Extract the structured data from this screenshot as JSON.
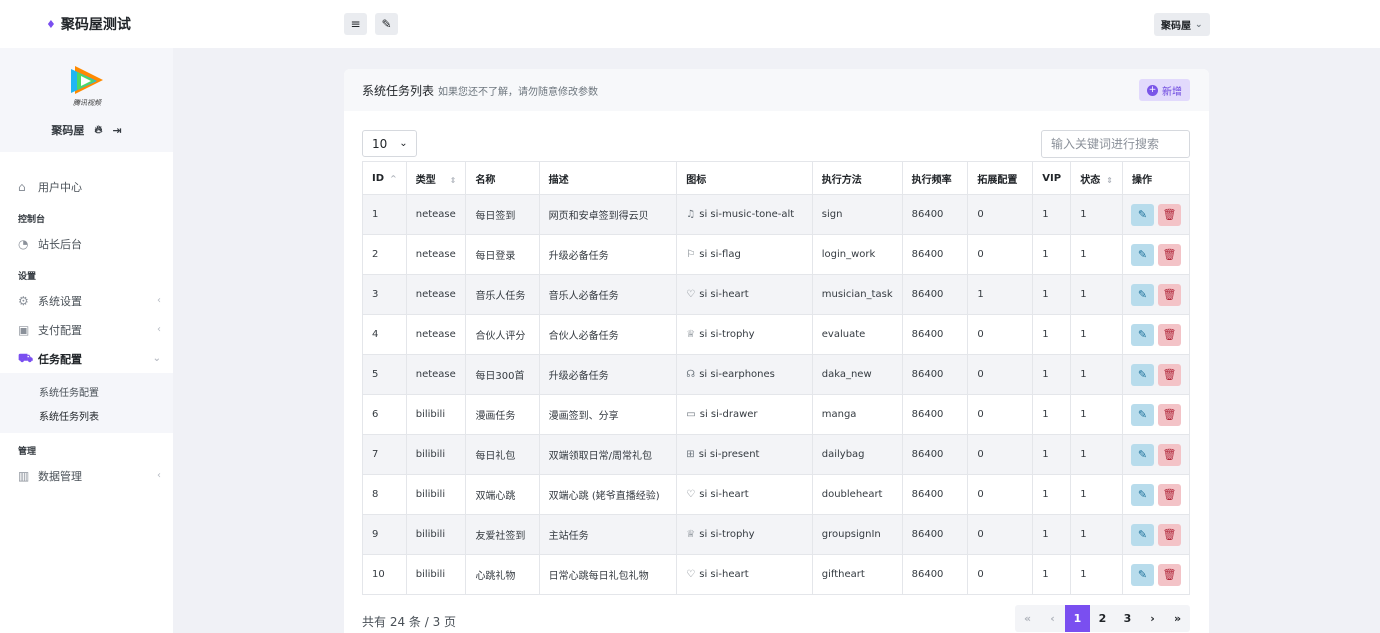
{
  "brand": {
    "title": "聚码屋测试"
  },
  "user": {
    "name": "聚码屋",
    "logo_text": "腾讯视频"
  },
  "sidebar": {
    "user_center": "用户中心",
    "sec_console": "控制台",
    "admin": "站长后台",
    "sec_settings": "设置",
    "system_settings": "系统设置",
    "payment_settings": "支付配置",
    "task_settings": "任务配置",
    "sub_task_config": "系统任务配置",
    "sub_task_list": "系统任务列表",
    "sec_manage": "管理",
    "data_manage": "数据管理"
  },
  "header": {
    "user_menu": "聚码屋"
  },
  "card": {
    "title": "系统任务列表",
    "subtitle": "如果您还不了解，请勿随意修改参数",
    "new_button": "新增"
  },
  "tools": {
    "page_size": "10",
    "search_placeholder": "输入关键词进行搜索"
  },
  "table": {
    "columns": [
      "ID",
      "类型",
      "名称",
      "描述",
      "图标",
      "执行方法",
      "执行频率",
      "拓展配置",
      "VIP",
      "状态",
      "操作"
    ],
    "rows": [
      {
        "id": "1",
        "type": "netease",
        "name": "每日签到",
        "desc": "网页和安卓签到得云贝",
        "icon_glyph": "♫",
        "icon": "si si-music-tone-alt",
        "method": "sign",
        "freq": "86400",
        "ext": "0",
        "vip": "1",
        "status": "1"
      },
      {
        "id": "2",
        "type": "netease",
        "name": "每日登录",
        "desc": "升级必备任务",
        "icon_glyph": "⚐",
        "icon": "si si-flag",
        "method": "login_work",
        "freq": "86400",
        "ext": "0",
        "vip": "1",
        "status": "1"
      },
      {
        "id": "3",
        "type": "netease",
        "name": "音乐人任务",
        "desc": "音乐人必备任务",
        "icon_glyph": "♡",
        "icon": "si si-heart",
        "method": "musician_task",
        "freq": "86400",
        "ext": "1",
        "vip": "1",
        "status": "1"
      },
      {
        "id": "4",
        "type": "netease",
        "name": "合伙人评分",
        "desc": "合伙人必备任务",
        "icon_glyph": "♕",
        "icon": "si si-trophy",
        "method": "evaluate",
        "freq": "86400",
        "ext": "0",
        "vip": "1",
        "status": "1"
      },
      {
        "id": "5",
        "type": "netease",
        "name": "每日300首",
        "desc": "升级必备任务",
        "icon_glyph": "☊",
        "icon": "si si-earphones",
        "method": "daka_new",
        "freq": "86400",
        "ext": "0",
        "vip": "1",
        "status": "1"
      },
      {
        "id": "6",
        "type": "bilibili",
        "name": "漫画任务",
        "desc": "漫画签到、分享",
        "icon_glyph": "▭",
        "icon": "si si-drawer",
        "method": "manga",
        "freq": "86400",
        "ext": "0",
        "vip": "1",
        "status": "1"
      },
      {
        "id": "7",
        "type": "bilibili",
        "name": "每日礼包",
        "desc": "双端领取日常/周常礼包",
        "icon_glyph": "⊞",
        "icon": "si si-present",
        "method": "dailybag",
        "freq": "86400",
        "ext": "0",
        "vip": "1",
        "status": "1"
      },
      {
        "id": "8",
        "type": "bilibili",
        "name": "双端心跳",
        "desc": "双端心跳 (姥爷直播经验)",
        "icon_glyph": "♡",
        "icon": "si si-heart",
        "method": "doubleheart",
        "freq": "86400",
        "ext": "0",
        "vip": "1",
        "status": "1"
      },
      {
        "id": "9",
        "type": "bilibili",
        "name": "友爱社签到",
        "desc": "主站任务",
        "icon_glyph": "♕",
        "icon": "si si-trophy",
        "method": "groupsignIn",
        "freq": "86400",
        "ext": "0",
        "vip": "1",
        "status": "1"
      },
      {
        "id": "10",
        "type": "bilibili",
        "name": "心跳礼物",
        "desc": "日常心跳每日礼包礼物",
        "icon_glyph": "♡",
        "icon": "si si-heart",
        "method": "giftheart",
        "freq": "86400",
        "ext": "0",
        "vip": "1",
        "status": "1"
      }
    ]
  },
  "footer": {
    "summary": "共有 24 条 / 3 页"
  },
  "pager": {
    "first": "«",
    "prev": "‹",
    "pages": [
      "1",
      "2",
      "3"
    ],
    "current": "1",
    "next": "›",
    "last": "»"
  },
  "colors": {
    "accent": "#7a4ff0",
    "edit": "#b8dcec",
    "delete": "#f3c3c7"
  }
}
